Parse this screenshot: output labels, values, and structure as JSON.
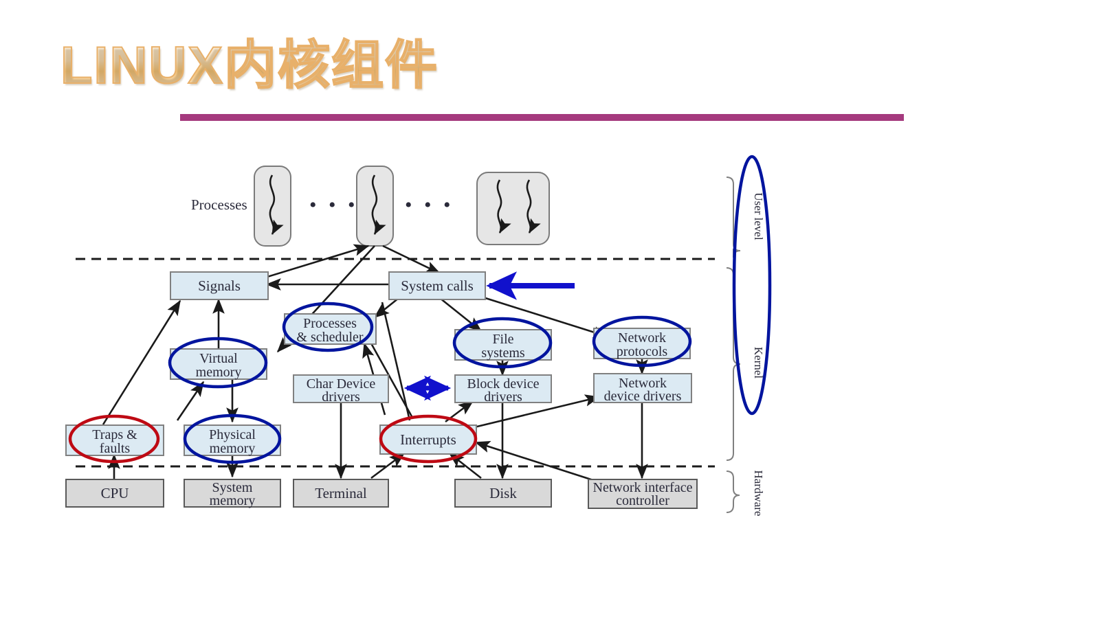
{
  "slide": {
    "title": "LINUX内核组件",
    "title_rule_color": "#A53A7E"
  },
  "diagram": {
    "caption_label": "Processes",
    "ellipsis_1": "• • •",
    "ellipsis_2": "• • •",
    "layer_labels": {
      "user": "User level",
      "kernel": "Kernel",
      "hardware": "Hardware"
    },
    "colors": {
      "kernel_box_fill": "#dceaf3",
      "kernel_box_stroke": "#808080",
      "hardware_box_fill": "#d9d9d9",
      "hardware_box_stroke": "#595959",
      "process_box_fill": "#e5e5e5",
      "highlight_blue": "#00149E",
      "highlight_red": "#BE0A14",
      "arrow_blue": "#1111CC",
      "line": "#1a1a1a"
    },
    "kernel_boxes": [
      {
        "id": "signals",
        "label_1": "Signals",
        "label_2": "",
        "highlight": "none"
      },
      {
        "id": "system-calls",
        "label_1": "System calls",
        "label_2": "",
        "highlight": "none"
      },
      {
        "id": "processes-scheduler",
        "label_1": "Processes",
        "label_2": "& scheduler",
        "highlight": "blue"
      },
      {
        "id": "file-systems",
        "label_1": "File",
        "label_2": "systems",
        "highlight": "blue"
      },
      {
        "id": "network-protocols",
        "label_1": "Network",
        "label_2": "protocols",
        "highlight": "blue"
      },
      {
        "id": "virtual-memory",
        "label_1": "Virtual",
        "label_2": "memory",
        "highlight": "blue"
      },
      {
        "id": "char-device-drivers",
        "label_1": "Char Device",
        "label_2": "drivers",
        "highlight": "none"
      },
      {
        "id": "block-device-drivers",
        "label_1": "Block device",
        "label_2": "drivers",
        "highlight": "none"
      },
      {
        "id": "network-device-drivers",
        "label_1": "Network",
        "label_2": "device drivers",
        "highlight": "none"
      },
      {
        "id": "traps-faults",
        "label_1": "Traps &",
        "label_2": "faults",
        "highlight": "red"
      },
      {
        "id": "physical-memory",
        "label_1": "Physical",
        "label_2": "memory",
        "highlight": "blue"
      },
      {
        "id": "interrupts",
        "label_1": "Interrupts",
        "label_2": "",
        "highlight": "red"
      }
    ],
    "hardware_boxes": [
      {
        "id": "cpu",
        "label_1": "CPU",
        "label_2": ""
      },
      {
        "id": "system-memory",
        "label_1": "System",
        "label_2": "memory"
      },
      {
        "id": "terminal",
        "label_1": "Terminal",
        "label_2": ""
      },
      {
        "id": "disk",
        "label_1": "Disk",
        "label_2": ""
      },
      {
        "id": "network-interface-controller",
        "label_1": "Network interface",
        "label_2": "controller"
      }
    ]
  }
}
